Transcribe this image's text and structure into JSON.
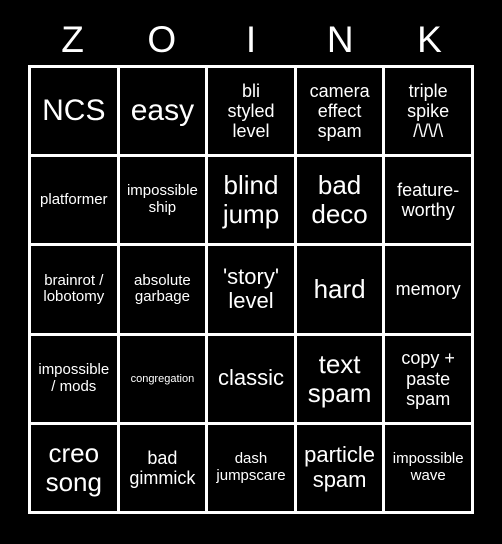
{
  "card": {
    "title": "ZOINK",
    "background_color": "#000000",
    "grid_line_color": "#ffffff",
    "cell_background_color": "#000000",
    "text_color": "#ffffff",
    "columns": 5,
    "rows": 5
  },
  "header": {
    "letters": [
      "Z",
      "O",
      "I",
      "N",
      "K"
    ]
  },
  "grid": {
    "rows": [
      {
        "cells": [
          {
            "text": "NCS",
            "size": "xxl"
          },
          {
            "text": "easy",
            "size": "xxl"
          },
          {
            "text": "bli\nstyled\nlevel",
            "size": "md"
          },
          {
            "text": "camera\neffect\nspam",
            "size": "md"
          },
          {
            "text": "triple\nspike\n/\\/\\/\\",
            "size": "md"
          }
        ]
      },
      {
        "cells": [
          {
            "text": "platformer",
            "size": "sm"
          },
          {
            "text": "impossible\nship",
            "size": "sm"
          },
          {
            "text": "blind\njump",
            "size": "xl"
          },
          {
            "text": "bad\ndeco",
            "size": "xl"
          },
          {
            "text": "feature-\nworthy",
            "size": "md"
          }
        ]
      },
      {
        "cells": [
          {
            "text": "brainrot /\nlobotomy",
            "size": "sm"
          },
          {
            "text": "absolute\ngarbage",
            "size": "sm"
          },
          {
            "text": "'story'\nlevel",
            "size": "lg"
          },
          {
            "text": "hard",
            "size": "xl"
          },
          {
            "text": "memory",
            "size": "md"
          }
        ]
      },
      {
        "cells": [
          {
            "text": "impossible\n/ mods",
            "size": "sm"
          },
          {
            "text": "congregation",
            "size": "xxs"
          },
          {
            "text": "classic",
            "size": "lg"
          },
          {
            "text": "text\nspam",
            "size": "xl"
          },
          {
            "text": "copy +\npaste\nspam",
            "size": "md"
          }
        ]
      },
      {
        "cells": [
          {
            "text": "creo\nsong",
            "size": "xl"
          },
          {
            "text": "bad\ngimmick",
            "size": "md"
          },
          {
            "text": "dash\njumpscare",
            "size": "sm"
          },
          {
            "text": "particle\nspam",
            "size": "lg"
          },
          {
            "text": "impossible\nwave",
            "size": "sm"
          }
        ]
      }
    ]
  }
}
